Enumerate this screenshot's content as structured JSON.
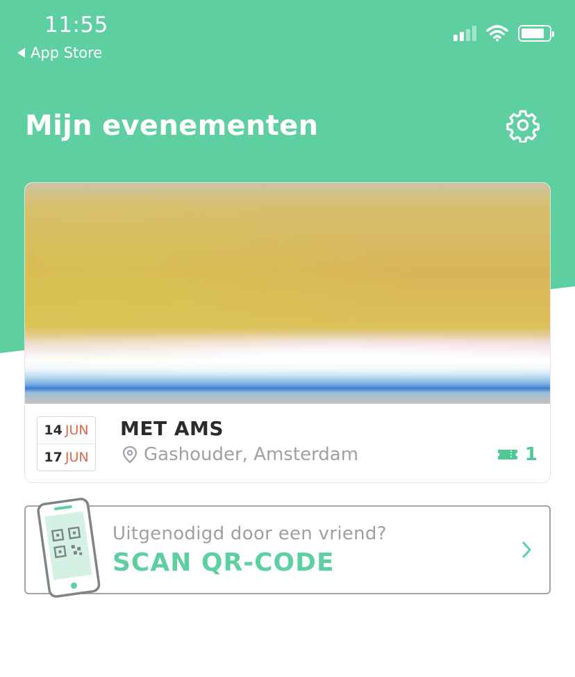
{
  "status_bar": {
    "time": "11:55",
    "back_label": "App Store",
    "icons": [
      "back-arrow-icon",
      "cellular-signal-icon",
      "wifi-icon",
      "battery-icon"
    ]
  },
  "header": {
    "title": "Mijn evenementen",
    "settings_icon": "gear-icon"
  },
  "event": {
    "start_day": "14",
    "start_month": "JUN",
    "end_day": "17",
    "end_month": "JUN",
    "name": "MET AMS",
    "location": "Gashouder, Amsterdam",
    "ticket_count": "1",
    "location_icon": "location-pin-icon",
    "ticket_icon": "ticket-icon"
  },
  "scan": {
    "subtitle": "Uitgenodigd door een vriend?",
    "title": "SCAN QR-CODE",
    "illustration": "phone-qr-icon",
    "chevron_icon": "chevron-right-icon"
  },
  "colors": {
    "brand_green": "#5ecfa0",
    "accent_green": "#4fc894",
    "month_red": "#e0664a",
    "muted_text": "#9ba1a6"
  }
}
